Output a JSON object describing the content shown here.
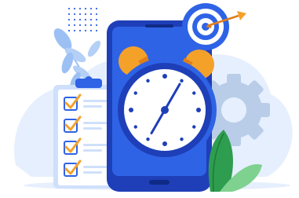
{
  "illustration": {
    "subject": "time-management",
    "checklist": {
      "items_checked": 4,
      "items_total": 4
    },
    "clock": {
      "hour_hand_points_to": 1,
      "minute_hand_points_to": 7
    }
  },
  "colors": {
    "primary_blue": "#2f63e6",
    "dark_blue": "#1e3fb8",
    "light_blue": "#cfe0fb",
    "pale_blue": "#e6effd",
    "orange": "#f4a12a",
    "dark_orange": "#e07f1a",
    "green_leaf": "#2e9d4f",
    "light_green_leaf": "#7fd18f",
    "gear_gray": "#b9cde8",
    "white": "#ffffff"
  }
}
